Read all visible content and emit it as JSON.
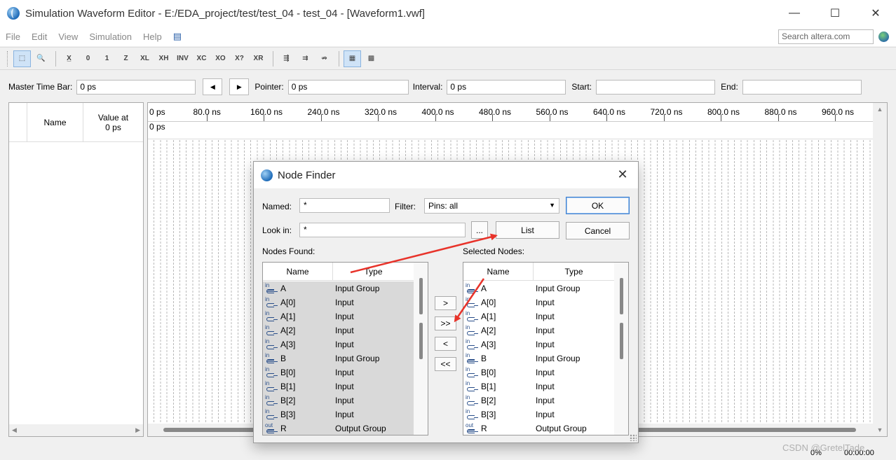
{
  "window": {
    "title": "Simulation Waveform Editor - E:/EDA_project/test/test_04 - test_04 - [Waveform1.vwf]",
    "minimize": "—",
    "maximize": "☐",
    "close": "✕"
  },
  "menu": {
    "items": [
      {
        "label": "File"
      },
      {
        "label": "Edit"
      },
      {
        "label": "View"
      },
      {
        "label": "Simulation"
      },
      {
        "label": "Help"
      }
    ],
    "search_placeholder": "Search altera.com"
  },
  "toolbar": {
    "tools": [
      {
        "name": "selection-tool-icon",
        "glyph": "⬚"
      },
      {
        "name": "zoom-tool-icon",
        "glyph": "🔍"
      },
      {
        "name": "forcing-unknown-icon",
        "glyph": "X̲"
      },
      {
        "name": "forcing-low-icon",
        "glyph": "0"
      },
      {
        "name": "forcing-high-icon",
        "glyph": "1"
      },
      {
        "name": "high-impedance-icon",
        "glyph": "Z"
      },
      {
        "name": "weak-low-icon",
        "glyph": "XL"
      },
      {
        "name": "weak-high-icon",
        "glyph": "XH"
      },
      {
        "name": "invert-icon",
        "glyph": "INV"
      },
      {
        "name": "count-value-icon",
        "glyph": "XC"
      },
      {
        "name": "clock-value-icon",
        "glyph": "XO"
      },
      {
        "name": "arbitrary-value-icon",
        "glyph": "X?"
      },
      {
        "name": "random-value-icon",
        "glyph": "XR"
      },
      {
        "name": "snap-grid-icon",
        "glyph": "⇶"
      },
      {
        "name": "group-icon",
        "glyph": "⇉"
      },
      {
        "name": "ungroup-icon",
        "glyph": "⇏"
      },
      {
        "name": "grid-toggle-icon",
        "glyph": "▦"
      },
      {
        "name": "node-table-icon",
        "glyph": "▩"
      }
    ]
  },
  "timebar": {
    "master_label": "Master Time Bar:",
    "master_value": "0 ps",
    "prev_glyph": "◀",
    "next_glyph": "▶",
    "pointer_label": "Pointer:",
    "pointer_value": "0 ps",
    "interval_label": "Interval:",
    "interval_value": "0 ps",
    "start_label": "Start:",
    "start_value": "",
    "end_label": "End:",
    "end_value": ""
  },
  "node_table": {
    "name_header": "Name",
    "value_header": "Value at",
    "value_header_2": "0 ps"
  },
  "waveform": {
    "ruler": [
      "0 ps",
      "80.0 ns",
      "160.0 ns",
      "240.0 ns",
      "320.0 ns",
      "400.0 ns",
      "480.0 ns",
      "560.0 ns",
      "640.0 ns",
      "720.0 ns",
      "800.0 ns",
      "880.0 ns",
      "960.0 ns"
    ],
    "cursor_label": "0 ps"
  },
  "status": {
    "percent": "0%",
    "time": "00:00:00"
  },
  "watermark": "CSDN @GretelTade",
  "dialog": {
    "title": "Node Finder",
    "named_label": "Named:",
    "named_value": "*",
    "filter_label": "Filter:",
    "filter_value": "Pins: all",
    "look_in_label": "Look in:",
    "look_in_value": "*",
    "browse_button": "...",
    "list_button": "List",
    "ok_button": "OK",
    "cancel_button": "Cancel",
    "nodes_found_label": "Nodes Found:",
    "selected_nodes_label": "Selected Nodes:",
    "col_name": "Name",
    "col_type": "Type",
    "move_one": ">",
    "move_all": ">>",
    "remove_one": "<",
    "remove_all": "<<",
    "nodes_found": [
      {
        "name": "A",
        "type": "Input Group",
        "dir": "in",
        "group": true
      },
      {
        "name": "A[0]",
        "type": "Input",
        "dir": "in",
        "group": false
      },
      {
        "name": "A[1]",
        "type": "Input",
        "dir": "in",
        "group": false
      },
      {
        "name": "A[2]",
        "type": "Input",
        "dir": "in",
        "group": false
      },
      {
        "name": "A[3]",
        "type": "Input",
        "dir": "in",
        "group": false
      },
      {
        "name": "B",
        "type": "Input Group",
        "dir": "in",
        "group": true
      },
      {
        "name": "B[0]",
        "type": "Input",
        "dir": "in",
        "group": false
      },
      {
        "name": "B[1]",
        "type": "Input",
        "dir": "in",
        "group": false
      },
      {
        "name": "B[2]",
        "type": "Input",
        "dir": "in",
        "group": false
      },
      {
        "name": "B[3]",
        "type": "Input",
        "dir": "in",
        "group": false
      },
      {
        "name": "R",
        "type": "Output Group",
        "dir": "out",
        "group": true
      }
    ],
    "selected_nodes": [
      {
        "name": "A",
        "type": "Input Group",
        "dir": "in",
        "group": true
      },
      {
        "name": "A[0]",
        "type": "Input",
        "dir": "in",
        "group": false
      },
      {
        "name": "A[1]",
        "type": "Input",
        "dir": "in",
        "group": false
      },
      {
        "name": "A[2]",
        "type": "Input",
        "dir": "in",
        "group": false
      },
      {
        "name": "A[3]",
        "type": "Input",
        "dir": "in",
        "group": false
      },
      {
        "name": "B",
        "type": "Input Group",
        "dir": "in",
        "group": true
      },
      {
        "name": "B[0]",
        "type": "Input",
        "dir": "in",
        "group": false
      },
      {
        "name": "B[1]",
        "type": "Input",
        "dir": "in",
        "group": false
      },
      {
        "name": "B[2]",
        "type": "Input",
        "dir": "in",
        "group": false
      },
      {
        "name": "B[3]",
        "type": "Input",
        "dir": "in",
        "group": false
      },
      {
        "name": "R",
        "type": "Output Group",
        "dir": "out",
        "group": true
      }
    ]
  },
  "annotation": {
    "arrow_color": "#e8332a"
  }
}
